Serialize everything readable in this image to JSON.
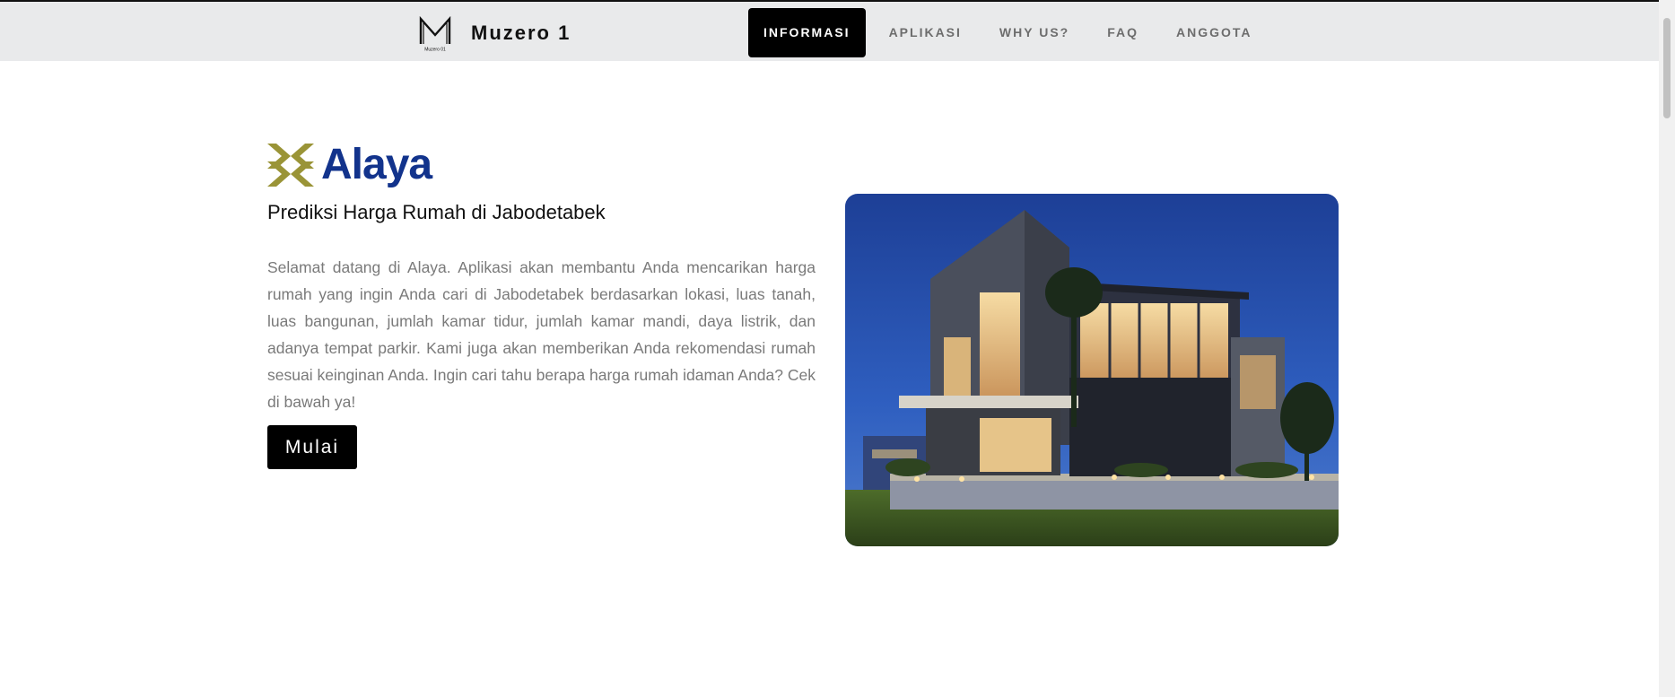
{
  "brand": {
    "name": "Muzero 1",
    "logo_icon": "muzero-m-logo-icon",
    "logo_caption": "Muzero 01"
  },
  "nav": {
    "items": [
      {
        "label": "INFORMASI",
        "active": true
      },
      {
        "label": "APLIKASI",
        "active": false
      },
      {
        "label": "WHY US?",
        "active": false
      },
      {
        "label": "FAQ",
        "active": false
      },
      {
        "label": "ANGGOTA",
        "active": false
      }
    ]
  },
  "hero": {
    "app_name": "Alaya",
    "logo_icon": "alaya-chevron-logo-icon",
    "subtitle": "Prediksi Harga Rumah di Jabodetabek",
    "description": "Selamat datang di Alaya. Aplikasi akan membantu Anda mencarikan harga rumah yang ingin Anda cari di Jabodetabek berdasarkan lokasi, luas tanah, luas bangunan, jumlah kamar tidur, jumlah kamar mandi, daya listrik, dan adanya tempat parkir. Kami juga akan memberikan Anda rekomendasi rumah sesuai keinginan Anda. Ingin cari tahu berapa harga rumah idaman Anda? Cek di bawah ya!",
    "cta_label": "Mulai",
    "image_icon": "modern-house-night-photo"
  },
  "colors": {
    "navbar_bg": "#e9eaeb",
    "accent_black": "#000000",
    "alaya_blue": "#12338c",
    "alaya_gold": "#9a9437",
    "body_text": "#7a7a7a"
  }
}
